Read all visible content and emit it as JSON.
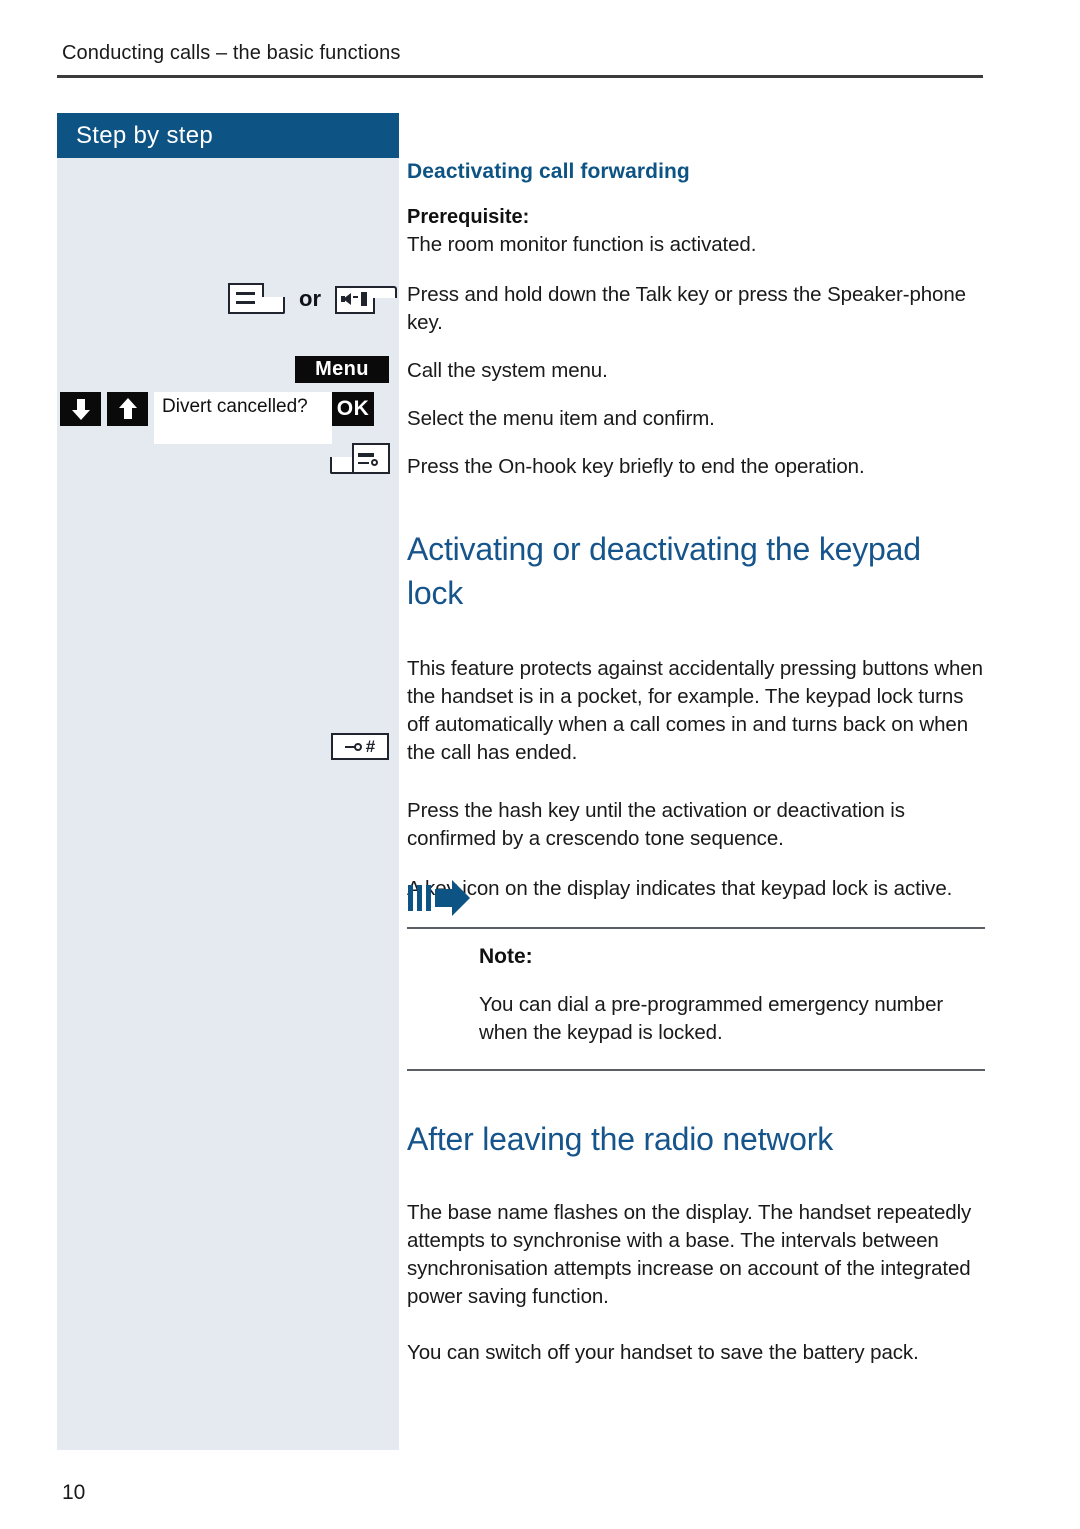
{
  "page": {
    "running_header": "Conducting calls – the basic functions",
    "page_number": "10"
  },
  "colors": {
    "brand_blue": "#0d5384",
    "heading_blue": "#16548c",
    "sidebar_bg": "#e4eaf0",
    "key_black": "#0a0a0a"
  },
  "step_column": {
    "title": "Step by step",
    "icons": {
      "talk_key": "talk-key-icon",
      "or_label": "or",
      "speakerphone_key": "speakerphone-key-icon",
      "menu_softkey": "Menu",
      "nav_down": "arrow-down-icon",
      "nav_up": "arrow-up-icon",
      "display_text": "Divert cancelled?",
      "ok_softkey": "OK",
      "onhook_key": "on-hook-key-icon",
      "hash_key_glyph": "#",
      "hash_key_icon": "key-lock-icon"
    }
  },
  "main": {
    "section1": {
      "heading": "Deactivating call forwarding",
      "prerequisite_label": "Prerequisite:",
      "prerequisite_text": "The room monitor function is activated.",
      "steps": [
        "Press and hold down the Talk key or press the Speaker-phone key.",
        "Call the system menu.",
        "Select the menu item and confirm.",
        "Press the On-hook key briefly to end the operation."
      ]
    },
    "section2": {
      "title": "Activating or deactivating the keypad lock",
      "intro": "This feature protects against accidentally pressing buttons when the handset is in a pocket, for example. The keypad lock turns off automatically when a call comes in and turns back on when the call has ended.",
      "hash_step": "Press the hash key until the activation or deactivation is confirmed by a crescendo tone sequence.",
      "key_icon_text": "A key icon on the display indicates that keypad lock is active.",
      "note": {
        "label": "Note:",
        "text": "You can dial a pre-programmed emergency number when the keypad is locked."
      }
    },
    "section3": {
      "title": "After leaving the radio network",
      "paragraphs": [
        "The base name flashes on the display. The handset repeatedly attempts to synchronise with a base. The intervals between synchronisation attempts increase on account of the integrated power saving function.",
        "You can switch off your handset to save the battery pack."
      ]
    }
  }
}
